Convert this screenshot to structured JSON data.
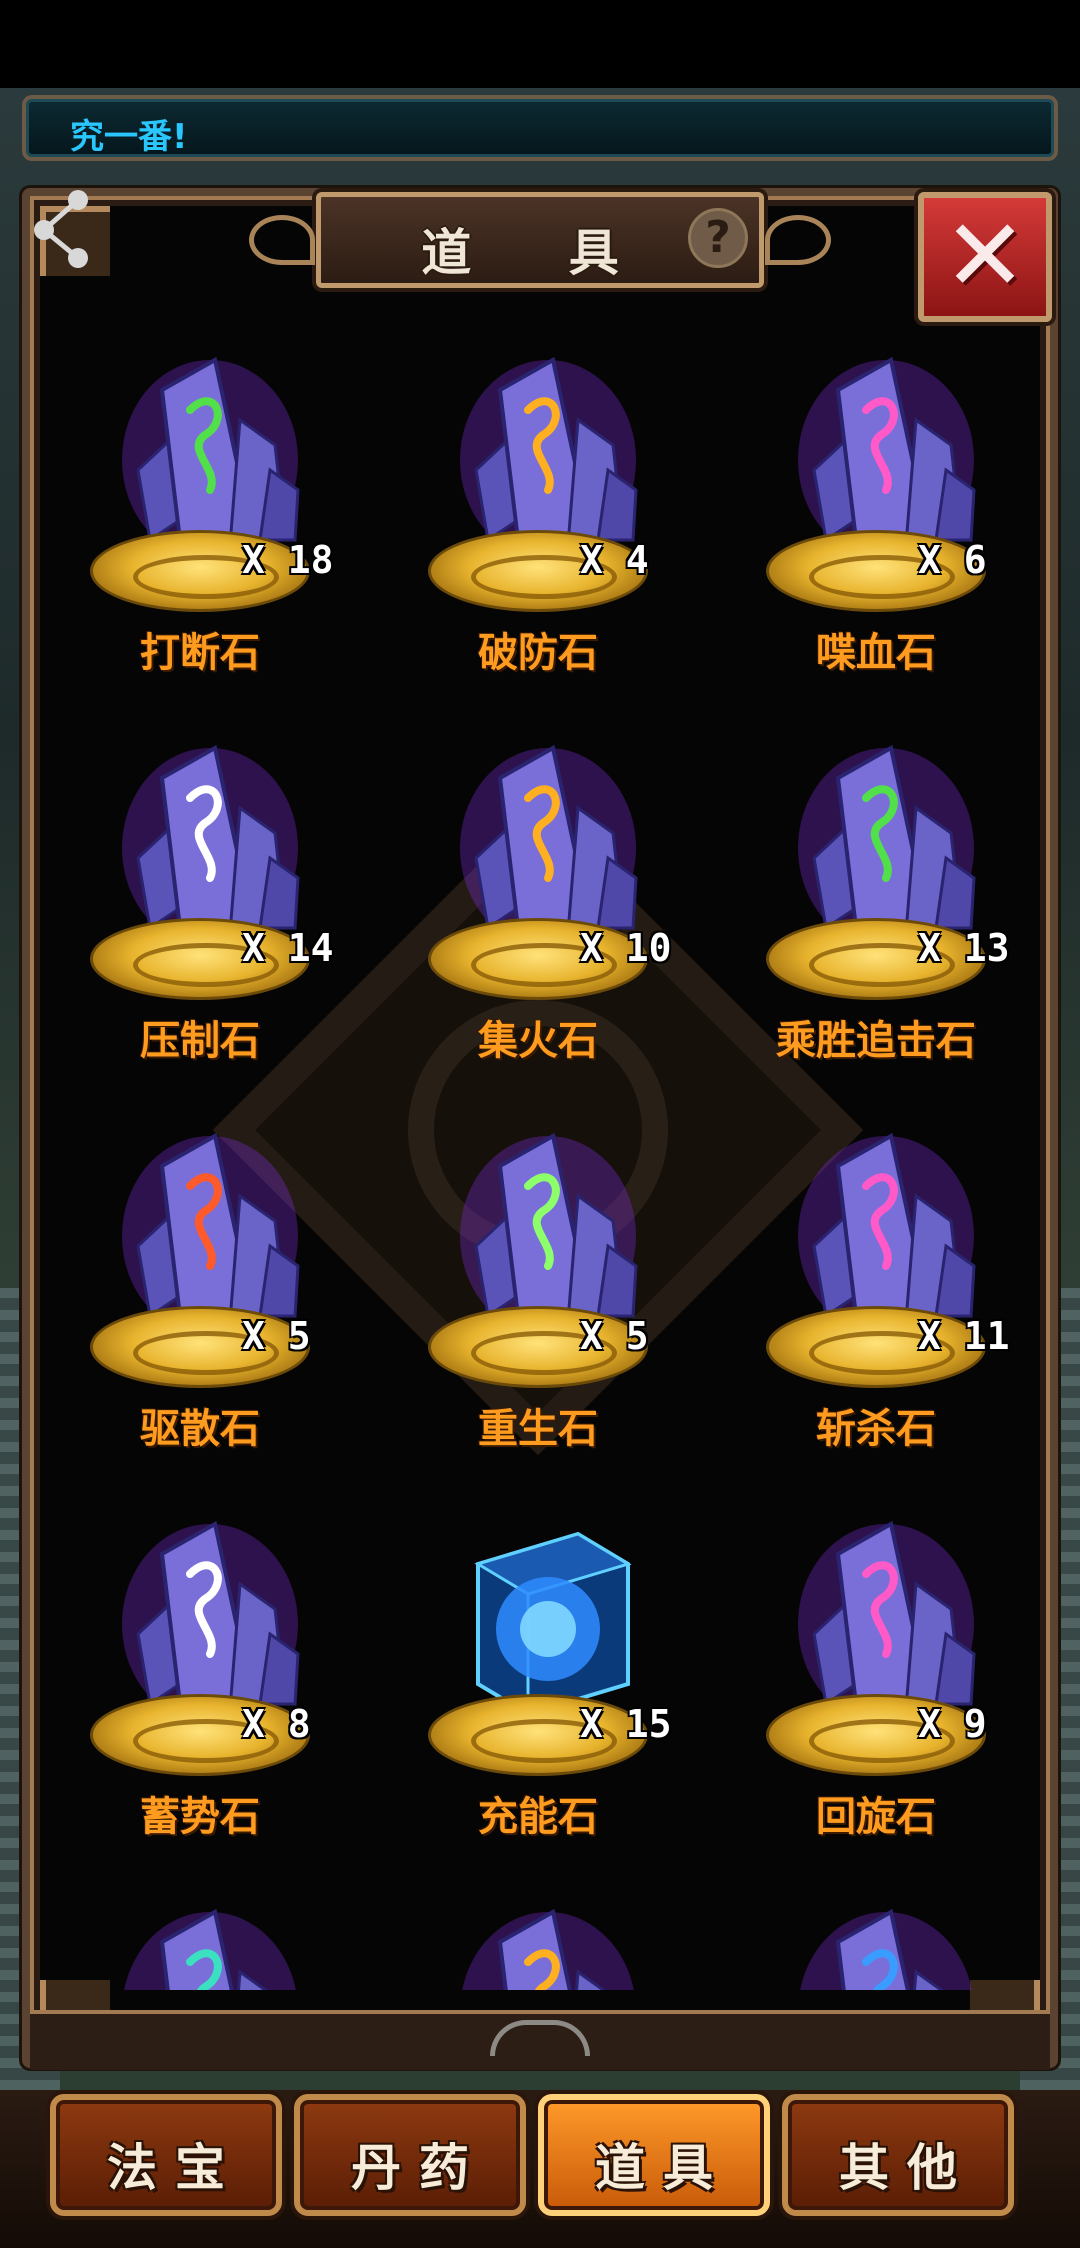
{
  "notice": {
    "text": "究一番!"
  },
  "header": {
    "title": "道 具",
    "help_glyph": "?",
    "close_glyph": "✕"
  },
  "items": [
    {
      "name": "打断石",
      "count": "X 18",
      "crystal_color": "#7a6fd8",
      "rune_color": "#52e04a"
    },
    {
      "name": "破防石",
      "count": "X 4",
      "crystal_color": "#7a6fd8",
      "rune_color": "#ffb020"
    },
    {
      "name": "喋血石",
      "count": "X 6",
      "crystal_color": "#7a6fd8",
      "rune_color": "#ff5ac8"
    },
    {
      "name": "压制石",
      "count": "X 14",
      "crystal_color": "#7a6fd8",
      "rune_color": "#ffffff"
    },
    {
      "name": "集火石",
      "count": "X 10",
      "crystal_color": "#7a6fd8",
      "rune_color": "#ffb020"
    },
    {
      "name": "乘胜追击石",
      "count": "X 13",
      "crystal_color": "#7a6fd8",
      "rune_color": "#52e04a"
    },
    {
      "name": "驱散石",
      "count": "X 5",
      "crystal_color": "#7a6fd8",
      "rune_color": "#ff5a2a"
    },
    {
      "name": "重生石",
      "count": "X 5",
      "crystal_color": "#7a6fd8",
      "rune_color": "#8cff6a"
    },
    {
      "name": "斩杀石",
      "count": "X 11",
      "crystal_color": "#7a6fd8",
      "rune_color": "#ff5ac8"
    },
    {
      "name": "蓄势石",
      "count": "X 8",
      "crystal_color": "#7a6fd8",
      "rune_color": "#ffffff"
    },
    {
      "name": "充能石",
      "count": "X 15",
      "crystal_color": "#2f8cff",
      "rune_color": "#7fd8ff",
      "icon": "energy-cube"
    },
    {
      "name": "回旋石",
      "count": "X 9",
      "crystal_color": "#7a6fd8",
      "rune_color": "#ff5ac8"
    },
    {
      "name": "",
      "count": "",
      "crystal_color": "#7a6fd8",
      "rune_color": "#3ae0c0"
    },
    {
      "name": "",
      "count": "",
      "crystal_color": "#7a6fd8",
      "rune_color": "#ffb020"
    },
    {
      "name": "",
      "count": "",
      "crystal_color": "#7a6fd8",
      "rune_color": "#3a9cff"
    }
  ],
  "tabs": [
    {
      "label": "法宝",
      "active": false
    },
    {
      "label": "丹药",
      "active": false
    },
    {
      "label": "道具",
      "active": true
    },
    {
      "label": "其他",
      "active": false
    }
  ]
}
